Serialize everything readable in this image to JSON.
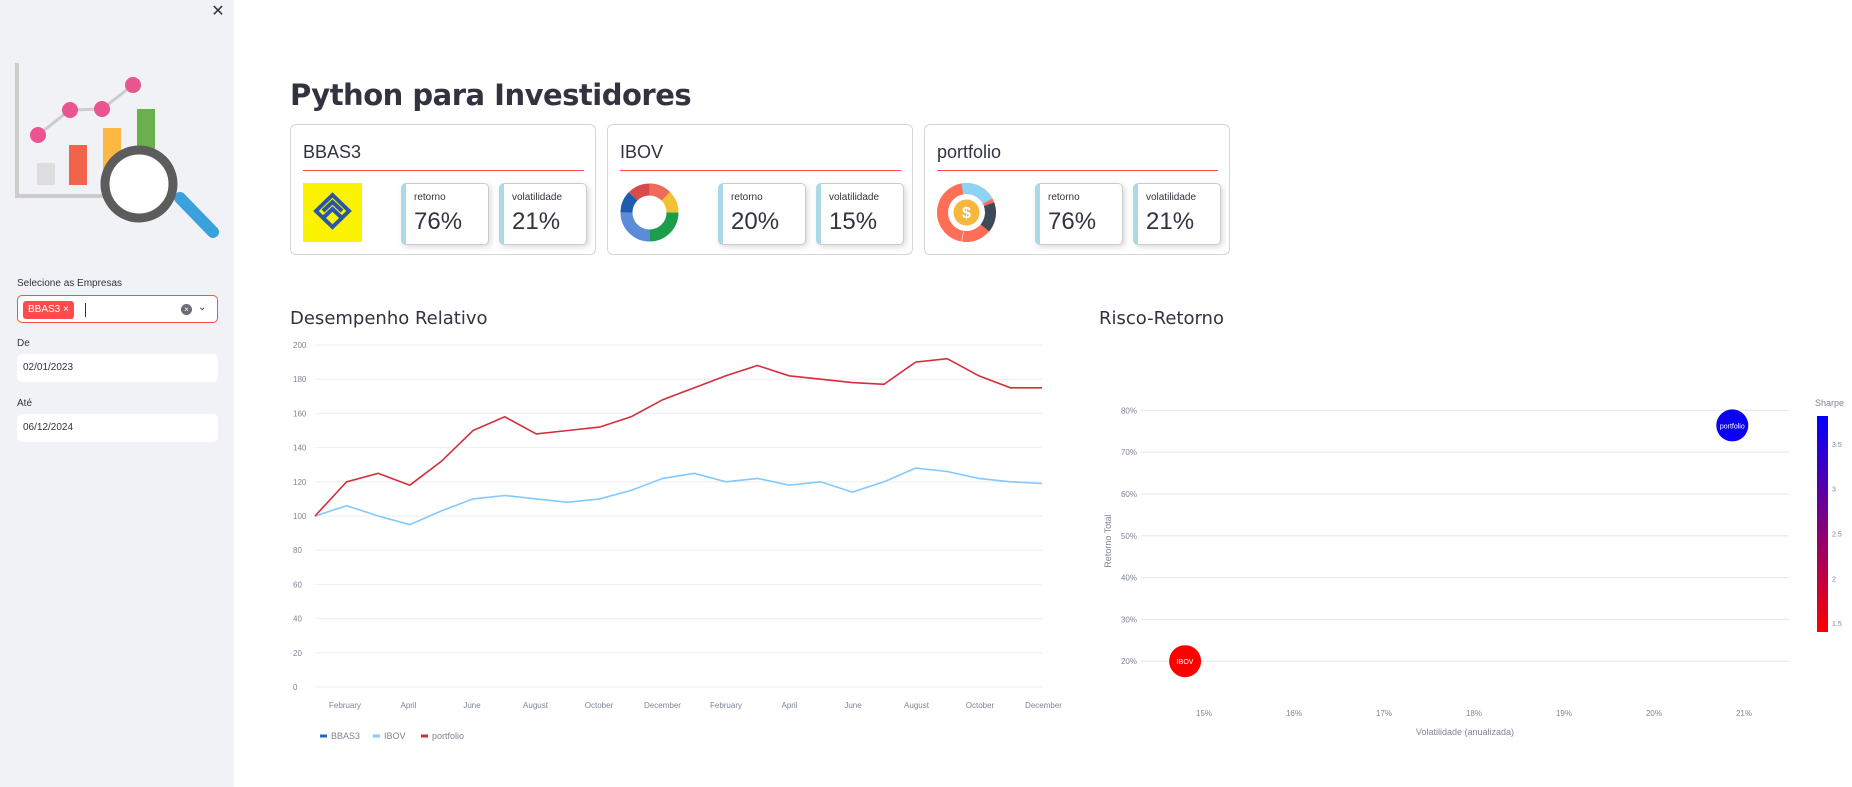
{
  "sidebar": {
    "close_icon": "close-icon",
    "multiselect": {
      "label": "Selecione as Empresas",
      "tags": [
        "BBAS3"
      ]
    },
    "from": {
      "label": "De",
      "value": "02/01/2023"
    },
    "to": {
      "label": "Até",
      "value": "06/12/2024"
    }
  },
  "page_title": "Python para Investidores",
  "cards": [
    {
      "title": "BBAS3",
      "logo": "banco-do-brasil-logo",
      "metrics": [
        {
          "label": "retorno",
          "value": "76%"
        },
        {
          "label": "volatilidade",
          "value": "21%"
        }
      ]
    },
    {
      "title": "IBOV",
      "logo": "donut-chart-icon",
      "metrics": [
        {
          "label": "retorno",
          "value": "20%"
        },
        {
          "label": "volatilidade",
          "value": "15%"
        }
      ]
    },
    {
      "title": "portfolio",
      "logo": "money-coin-icon",
      "metrics": [
        {
          "label": "retorno",
          "value": "76%"
        },
        {
          "label": "volatilidade",
          "value": "21%"
        }
      ]
    }
  ],
  "colors": {
    "accent": "#ff4b4b",
    "metric_border": "#add8e6",
    "sidebar_bg": "#f0f2f6"
  },
  "chart_data": [
    {
      "type": "line",
      "title": "Desempenho Relativo",
      "ylim": [
        0,
        200
      ],
      "yticks": [
        "0",
        "20",
        "40",
        "60",
        "80",
        "100",
        "120",
        "140",
        "160",
        "180",
        "200"
      ],
      "xticks": [
        "February",
        "April",
        "June",
        "August",
        "October",
        "December",
        "February",
        "April",
        "June",
        "August",
        "October",
        "December"
      ],
      "x": [
        "2023-01",
        "2023-02",
        "2023-03",
        "2023-04",
        "2023-05",
        "2023-06",
        "2023-07",
        "2023-08",
        "2023-09",
        "2023-10",
        "2023-11",
        "2023-12",
        "2024-01",
        "2024-02",
        "2024-03",
        "2024-04",
        "2024-05",
        "2024-06",
        "2024-07",
        "2024-08",
        "2024-09",
        "2024-10",
        "2024-11",
        "2024-12"
      ],
      "series": [
        {
          "name": "BBAS3",
          "color": "#1f67c8",
          "values": [
            100,
            120,
            125,
            118,
            132,
            150,
            158,
            148,
            150,
            152,
            158,
            168,
            175,
            182,
            188,
            182,
            180,
            178,
            177,
            190,
            192,
            182,
            175,
            175
          ]
        },
        {
          "name": "IBOV",
          "color": "#83c9ff",
          "values": [
            100,
            106,
            100,
            95,
            103,
            110,
            112,
            110,
            108,
            110,
            115,
            122,
            125,
            120,
            122,
            118,
            120,
            114,
            120,
            128,
            126,
            122,
            120,
            119
          ]
        },
        {
          "name": "portfolio",
          "color": "#d62d3b",
          "values": [
            100,
            120,
            125,
            118,
            132,
            150,
            158,
            148,
            150,
            152,
            158,
            168,
            175,
            182,
            188,
            182,
            180,
            178,
            177,
            190,
            192,
            182,
            175,
            175
          ]
        }
      ],
      "legend": [
        "BBAS3",
        "IBOV",
        "portfolio"
      ]
    },
    {
      "type": "scatter",
      "title": "Risco-Retorno",
      "xlabel": "Volatilidade (anualizada)",
      "ylabel": "Retorno Total",
      "xticks": [
        "15%",
        "16%",
        "17%",
        "18%",
        "19%",
        "20%",
        "21%"
      ],
      "yticks": [
        "20%",
        "30%",
        "40%",
        "50%",
        "60%",
        "70%",
        "80%"
      ],
      "xlim": [
        14.3,
        21.5
      ],
      "ylim": [
        15.5,
        82
      ],
      "points": [
        {
          "label": "IBOV",
          "x": 14.79,
          "y": 20.0,
          "sharpe": 1.4
        },
        {
          "label": "portfolio",
          "x": 20.87,
          "y": 76.4,
          "sharpe": 3.6
        }
      ],
      "colorbar": {
        "title": "Sharpe",
        "ticks": [
          "1.5",
          "2",
          "2.5",
          "3",
          "3.5"
        ]
      }
    }
  ]
}
